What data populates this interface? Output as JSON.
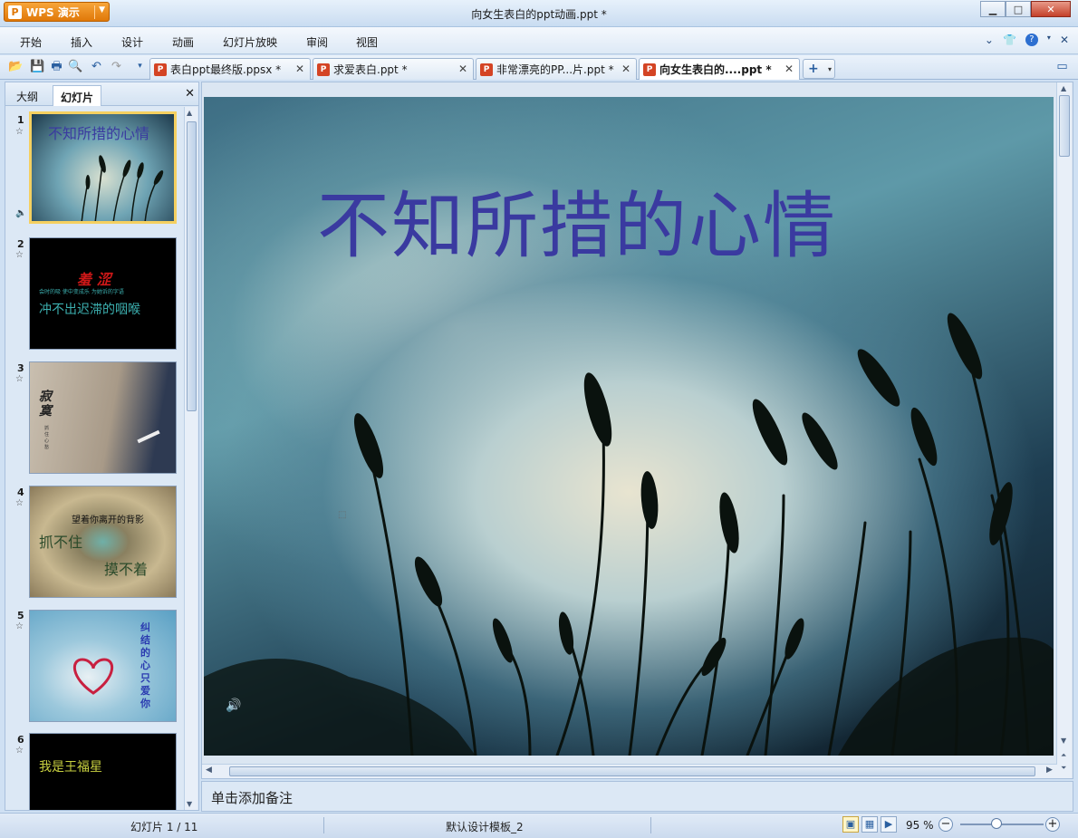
{
  "titlebar": {
    "app_name": "WPS 演示",
    "logo_text": "P",
    "window_title": "向女生表白的ppt动画.ppt *"
  },
  "menu": {
    "items": [
      "开始",
      "插入",
      "设计",
      "动画",
      "幻灯片放映",
      "审阅",
      "视图"
    ]
  },
  "doc_tabs": [
    {
      "label": "表白ppt最终版.ppsx *",
      "active": false
    },
    {
      "label": "求爱表白.ppt *",
      "active": false
    },
    {
      "label": "非常漂亮的PP...片.ppt *",
      "active": false
    },
    {
      "label": "向女生表白的....ppt *",
      "active": true
    }
  ],
  "left_panel": {
    "tabs": [
      "大纲",
      "幻灯片"
    ],
    "active_tab": "幻灯片",
    "slides": [
      {
        "number": "1",
        "title": "不知所措的心情"
      },
      {
        "number": "2",
        "title": "羞 涩",
        "subtitle": "冲不出迟滞的咽喉",
        "small": "会时的吸 使中变成乐 为她诉的字语"
      },
      {
        "number": "3",
        "title": "寂寞",
        "small": "抓住心 愁"
      },
      {
        "number": "4",
        "title": "望着你离开的背影",
        "line2": "抓不住",
        "line3": "摸不着"
      },
      {
        "number": "5",
        "title": "纠结的心只爱你"
      },
      {
        "number": "6",
        "title": "我是王福星"
      }
    ]
  },
  "slide": {
    "title": "不知所措的心情"
  },
  "notes": {
    "placeholder": "单击添加备注"
  },
  "status": {
    "slide_indicator": "幻灯片 1 / 11",
    "template": "默认设计模板_2",
    "zoom": "95 %"
  },
  "colors": {
    "title_blue": "#3a3aa0",
    "accent_orange": "#e07808"
  }
}
